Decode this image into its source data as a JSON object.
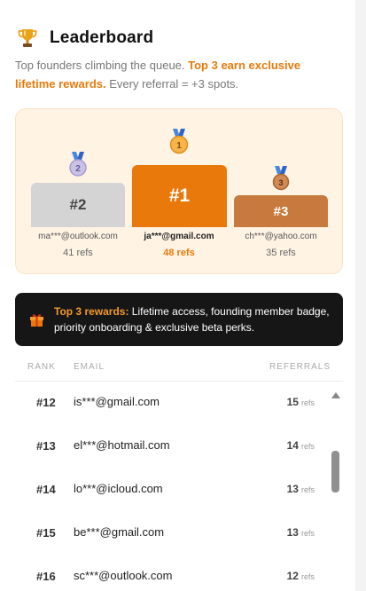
{
  "header": {
    "title": "Leaderboard",
    "trophy_icon": "trophy-icon",
    "subtitle_plain": "Top founders climbing the queue. ",
    "subtitle_highlight": "Top 3 earn exclusive lifetime rewards.",
    "subtitle_tail": " Every referral = +3 spots."
  },
  "podium": {
    "places": [
      {
        "rank": "#2",
        "email": "ma***@outlook.com",
        "refs": "41 refs",
        "medal": "2"
      },
      {
        "rank": "#1",
        "email": "ja***@gmail.com",
        "refs": "48 refs",
        "medal": "1"
      },
      {
        "rank": "#3",
        "email": "ch***@yahoo.com",
        "refs": "35 refs",
        "medal": "3"
      }
    ]
  },
  "rewards": {
    "icon": "gift-icon",
    "label": "Top 3 rewards:",
    "text": " Lifetime access, founding member badge, priority onboarding & exclusive beta perks."
  },
  "table": {
    "columns": [
      "RANK",
      "EMAIL",
      "REFERRALS"
    ],
    "refs_unit": "refs",
    "rows": [
      {
        "rank": "#12",
        "email": "is***@gmail.com",
        "refs": "15"
      },
      {
        "rank": "#13",
        "email": "el***@hotmail.com",
        "refs": "14"
      },
      {
        "rank": "#14",
        "email": "lo***@icloud.com",
        "refs": "13"
      },
      {
        "rank": "#15",
        "email": "be***@gmail.com",
        "refs": "13"
      },
      {
        "rank": "#16",
        "email": "sc***@outlook.com",
        "refs": "12"
      }
    ]
  },
  "colors": {
    "accent": "#e8790a",
    "podium_bg": "#fff3e4",
    "silver": "#d4d4d4",
    "bronze": "#c87a3e",
    "rewards_bg": "#161616"
  }
}
